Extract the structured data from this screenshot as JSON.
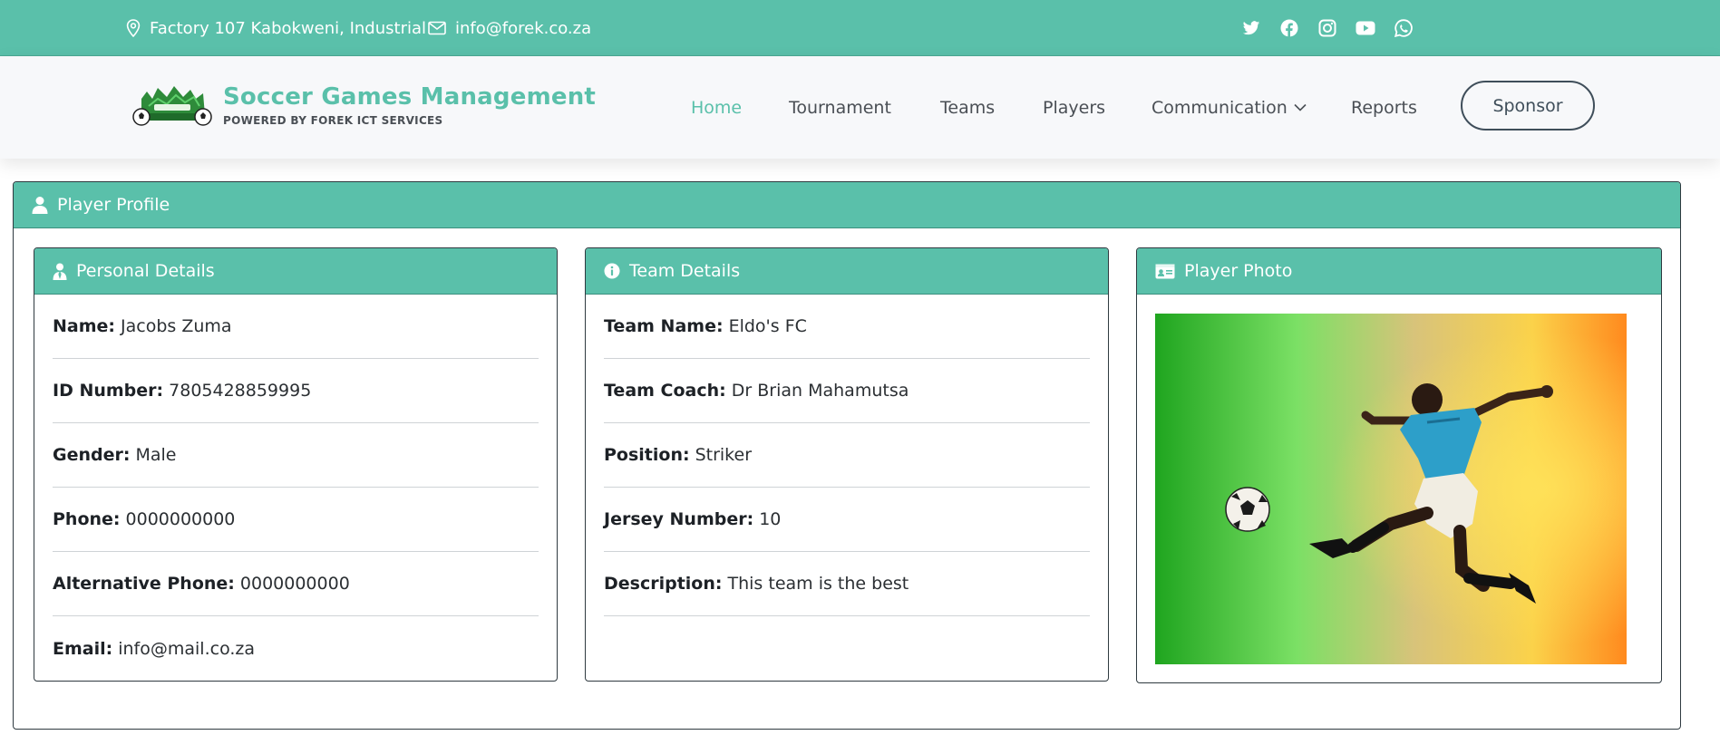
{
  "topbar": {
    "address": "Factory 107 Kabokweni, Industrial",
    "email": "info@forek.co.za",
    "socials": [
      "twitter-icon",
      "facebook-icon",
      "instagram-icon",
      "youtube-icon",
      "whatsapp-icon"
    ]
  },
  "brand": {
    "title": "Soccer Games Management",
    "subtitle": "POWERED BY FOREK ICT SERVICES"
  },
  "nav": {
    "items": [
      {
        "label": "Home",
        "active": true
      },
      {
        "label": "Tournament"
      },
      {
        "label": "Teams"
      },
      {
        "label": "Players"
      },
      {
        "label": "Communication",
        "dropdown": true
      },
      {
        "label": "Reports"
      }
    ],
    "sponsor_label": "Sponsor"
  },
  "profile": {
    "title": "Player Profile",
    "personal": {
      "title": "Personal Details",
      "fields": [
        {
          "label": "Name:",
          "value": "Jacobs Zuma"
        },
        {
          "label": "ID Number:",
          "value": "7805428859995"
        },
        {
          "label": "Gender:",
          "value": "Male"
        },
        {
          "label": "Phone:",
          "value": "0000000000"
        },
        {
          "label": "Alternative Phone:",
          "value": "0000000000"
        },
        {
          "label": "Email:",
          "value": "info@mail.co.za"
        }
      ]
    },
    "team": {
      "title": "Team Details",
      "fields": [
        {
          "label": "Team Name:",
          "value": "Eldo's FC"
        },
        {
          "label": "Team Coach:",
          "value": "Dr Brian Mahamutsa"
        },
        {
          "label": "Position:",
          "value": "Striker"
        },
        {
          "label": "Jersey Number:",
          "value": "10"
        },
        {
          "label": "Description:",
          "value": "This team is the best"
        }
      ]
    },
    "photo": {
      "title": "Player Photo"
    }
  },
  "colors": {
    "accent": "#5ac0aa",
    "text": "#212529",
    "border": "#2f3a40"
  }
}
